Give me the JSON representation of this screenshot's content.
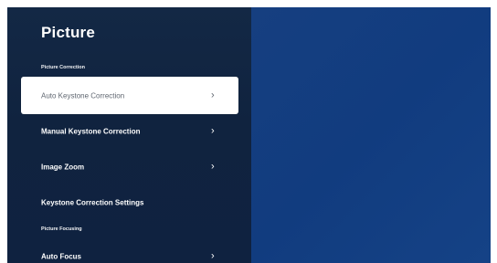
{
  "title": "Picture",
  "sections": {
    "picture_correction": "Picture Correction",
    "picture_focusing": "Picture Focusing"
  },
  "items": [
    {
      "label": "Auto Keystone Correction",
      "chevron": "›"
    },
    {
      "label": "Manual Keystone Correction",
      "chevron": "›"
    },
    {
      "label": "Image Zoom",
      "chevron": "›"
    },
    {
      "label": "Keystone Correction Settings"
    },
    {
      "label": "Auto Focus",
      "chevron": "›"
    }
  ],
  "colors": {
    "panel_bg": "#10233f",
    "right_bg": "#113c7f",
    "selected_bg": "#ffffff",
    "selected_text": "#5f6670",
    "text": "#ffffff"
  },
  "icons": {
    "chevron": "chevron-right-icon"
  }
}
